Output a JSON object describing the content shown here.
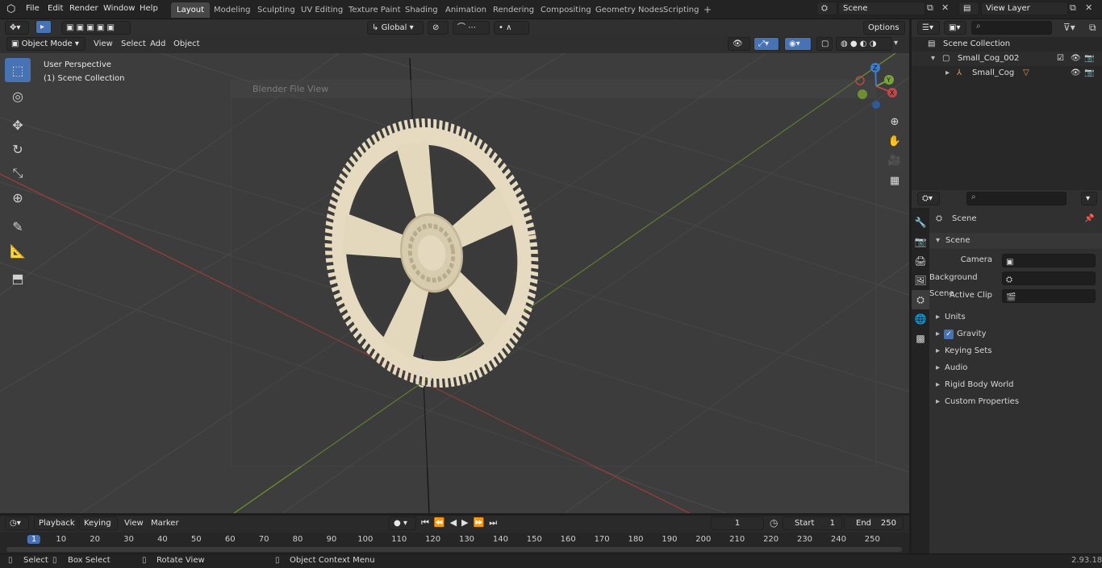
{
  "menu": {
    "file": "File",
    "edit": "Edit",
    "render": "Render",
    "window": "Window",
    "help": "Help"
  },
  "workspaces": [
    "Layout",
    "Modeling",
    "Sculpting",
    "UV Editing",
    "Texture Paint",
    "Shading",
    "Animation",
    "Rendering",
    "Compositing",
    "Geometry Nodes",
    "Scripting"
  ],
  "scene": {
    "name": "Scene",
    "view_layer": "View Layer"
  },
  "header": {
    "orientation": "Global",
    "options": "Options",
    "mode": "Object Mode",
    "view": "View",
    "select": "Select",
    "add": "Add",
    "object": "Object"
  },
  "viewport": {
    "perspective": "User Perspective",
    "collection": "(1) Scene Collection",
    "dialog_title": "Blender File View"
  },
  "outliner": {
    "root": "Scene Collection",
    "items": [
      {
        "label": "Small_Cog_002"
      },
      {
        "label": "Small_Cog"
      }
    ]
  },
  "properties": {
    "scene_label": "Scene",
    "panel": "Scene",
    "camera": "Camera",
    "background_scene": "Background Scene",
    "active_clip": "Active Clip",
    "sections": [
      "Units",
      "Gravity",
      "Keying Sets",
      "Audio",
      "Rigid Body World",
      "Custom Properties"
    ]
  },
  "timeline": {
    "playback": "Playback",
    "keying": "Keying",
    "view": "View",
    "marker": "Marker",
    "current_frame": "1",
    "start_label": "Start",
    "start": "1",
    "end_label": "End",
    "end": "250",
    "ticks": [
      "1",
      "10",
      "20",
      "30",
      "40",
      "50",
      "60",
      "70",
      "80",
      "90",
      "100",
      "110",
      "120",
      "130",
      "140",
      "150",
      "160",
      "170",
      "180",
      "190",
      "200",
      "210",
      "220",
      "230",
      "240",
      "250"
    ]
  },
  "status": {
    "select": "Select",
    "box_select": "Box Select",
    "rotate_view": "Rotate View",
    "context_menu": "Object Context Menu",
    "version": "2.93.18"
  },
  "colors": {
    "accent": "#4772b3",
    "x_axis": "#b34a4a",
    "y_axis": "#7aa23a",
    "z_axis": "#3b7bd0",
    "gear": "#e8dcc0"
  }
}
